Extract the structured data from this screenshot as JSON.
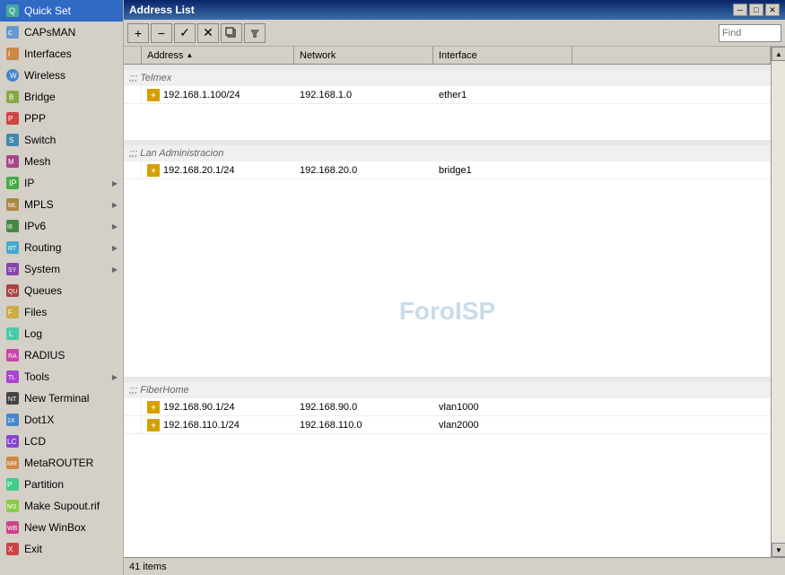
{
  "sidebar": {
    "items": [
      {
        "id": "quickset",
        "label": "Quick Set",
        "icon": "icon-quickset",
        "hasArrow": false
      },
      {
        "id": "capsman",
        "label": "CAPsMAN",
        "icon": "icon-capsman",
        "hasArrow": false
      },
      {
        "id": "interfaces",
        "label": "Interfaces",
        "icon": "icon-interfaces",
        "hasArrow": false
      },
      {
        "id": "wireless",
        "label": "Wireless",
        "icon": "icon-wireless",
        "hasArrow": false
      },
      {
        "id": "bridge",
        "label": "Bridge",
        "icon": "icon-bridge",
        "hasArrow": false
      },
      {
        "id": "ppp",
        "label": "PPP",
        "icon": "icon-ppp",
        "hasArrow": false
      },
      {
        "id": "switch",
        "label": "Switch",
        "icon": "icon-switch",
        "hasArrow": false
      },
      {
        "id": "mesh",
        "label": "Mesh",
        "icon": "icon-mesh",
        "hasArrow": false
      },
      {
        "id": "ip",
        "label": "IP",
        "icon": "icon-ip",
        "hasArrow": true
      },
      {
        "id": "mpls",
        "label": "MPLS",
        "icon": "icon-mpls",
        "hasArrow": true
      },
      {
        "id": "ipv6",
        "label": "IPv6",
        "icon": "icon-ipv6",
        "hasArrow": true
      },
      {
        "id": "routing",
        "label": "Routing",
        "icon": "icon-routing",
        "hasArrow": true
      },
      {
        "id": "system",
        "label": "System",
        "icon": "icon-system",
        "hasArrow": true
      },
      {
        "id": "queues",
        "label": "Queues",
        "icon": "icon-queues",
        "hasArrow": false
      },
      {
        "id": "files",
        "label": "Files",
        "icon": "icon-files",
        "hasArrow": false
      },
      {
        "id": "log",
        "label": "Log",
        "icon": "icon-log",
        "hasArrow": false
      },
      {
        "id": "radius",
        "label": "RADIUS",
        "icon": "icon-radius",
        "hasArrow": false
      },
      {
        "id": "tools",
        "label": "Tools",
        "icon": "icon-tools",
        "hasArrow": true
      },
      {
        "id": "newterminal",
        "label": "New Terminal",
        "icon": "icon-newterminal",
        "hasArrow": false
      },
      {
        "id": "dot1x",
        "label": "Dot1X",
        "icon": "icon-dot1x",
        "hasArrow": false
      },
      {
        "id": "lcd",
        "label": "LCD",
        "icon": "icon-lcd",
        "hasArrow": false
      },
      {
        "id": "metarouter",
        "label": "MetaROUTER",
        "icon": "icon-metarouter",
        "hasArrow": false
      },
      {
        "id": "partition",
        "label": "Partition",
        "icon": "icon-partition",
        "hasArrow": false
      },
      {
        "id": "makesupout",
        "label": "Make Supout.rif",
        "icon": "icon-makesupout",
        "hasArrow": false
      },
      {
        "id": "newwinbox",
        "label": "New WinBox",
        "icon": "icon-newwinbox",
        "hasArrow": false
      },
      {
        "id": "exit",
        "label": "Exit",
        "icon": "icon-exit",
        "hasArrow": false
      }
    ]
  },
  "window": {
    "title": "Address List",
    "find_placeholder": "Find"
  },
  "toolbar": {
    "add": "+",
    "remove": "−",
    "check": "✓",
    "cross": "✕",
    "copy": "❐",
    "filter": "▼"
  },
  "table": {
    "columns": [
      {
        "id": "address",
        "label": "Address",
        "sort": "asc"
      },
      {
        "id": "network",
        "label": "Network"
      },
      {
        "id": "interface",
        "label": "Interface"
      }
    ],
    "sections": [
      {
        "label": ";;; Telmex",
        "rows": [
          {
            "address": "192.168.1.100/24",
            "network": "192.168.1.0",
            "interface": "ether1"
          }
        ]
      },
      {
        "label": ";;; Lan Administracion",
        "rows": [
          {
            "address": "192.168.20.1/24",
            "network": "192.168.20.0",
            "interface": "bridge1"
          }
        ]
      },
      {
        "label": ";;; FiberHome",
        "rows": [
          {
            "address": "192.168.90.1/24",
            "network": "192.168.90.0",
            "interface": "vlan1000"
          },
          {
            "address": "192.168.110.1/24",
            "network": "192.168.110.0",
            "interface": "vlan2000"
          }
        ]
      }
    ]
  },
  "watermark": "ForoISP",
  "status": {
    "count": "41 items"
  }
}
